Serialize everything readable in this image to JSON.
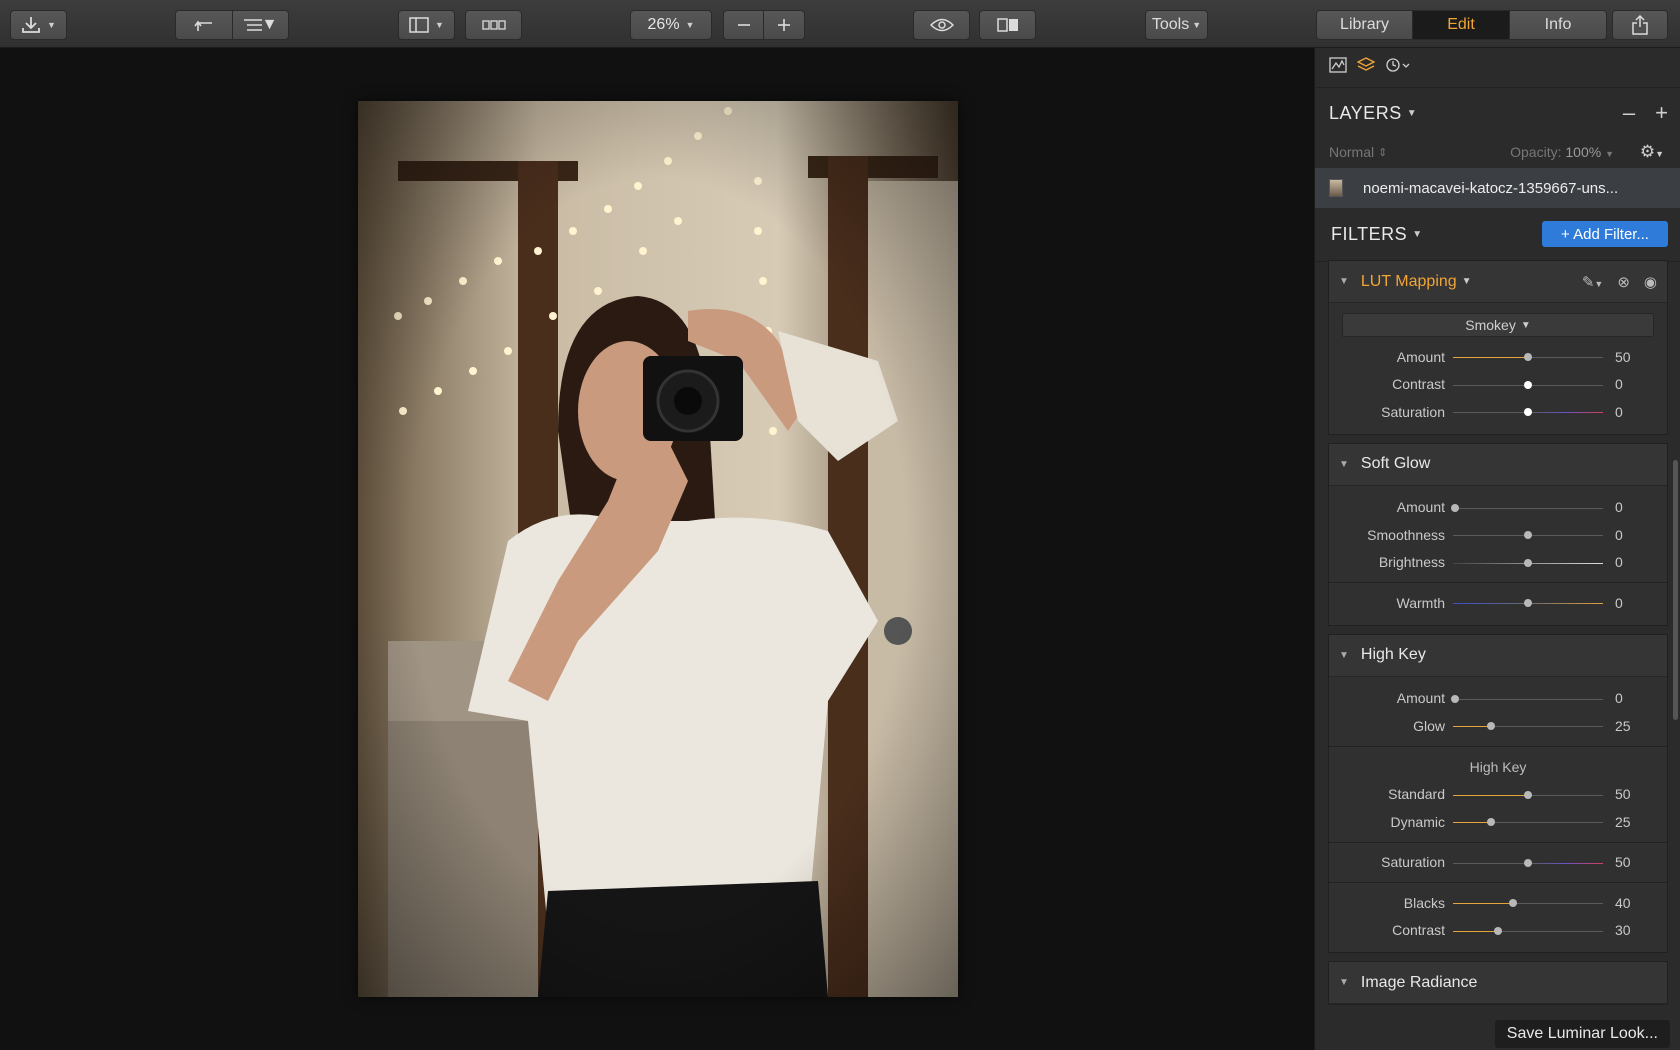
{
  "toolbar": {
    "zoom": "26%",
    "tools_label": "Tools",
    "tabs": [
      {
        "label": "Library",
        "active": false
      },
      {
        "label": "Edit",
        "active": true
      },
      {
        "label": "Info",
        "active": false
      }
    ]
  },
  "layers": {
    "title": "LAYERS",
    "blend_mode": "Normal",
    "opacity_label": "Opacity:",
    "opacity_value": "100%",
    "layer_name": "noemi-macavei-katocz-1359667-uns..."
  },
  "filters": {
    "title": "FILTERS",
    "add_label": "+ Add Filter...",
    "lut": {
      "name": "LUT Mapping",
      "preset": "Smokey",
      "sliders": [
        {
          "label": "Amount",
          "value": "50",
          "pos": 0.5,
          "fill": true
        },
        {
          "label": "Contrast",
          "value": "0",
          "pos": 0.5,
          "fill": false
        },
        {
          "label": "Saturation",
          "value": "0",
          "pos": 0.5,
          "fill": false
        }
      ]
    },
    "soft_glow": {
      "name": "Soft Glow",
      "sliders": [
        {
          "label": "Amount",
          "value": "0",
          "pos": 0.0
        },
        {
          "label": "Smoothness",
          "value": "0",
          "pos": 0.5
        },
        {
          "label": "Brightness",
          "value": "0",
          "pos": 0.5
        },
        {
          "label": "Warmth",
          "value": "0",
          "pos": 0.5
        }
      ]
    },
    "high_key": {
      "name": "High Key",
      "sub_label": "High Key",
      "sliders": [
        {
          "label": "Amount",
          "value": "0",
          "pos": 0.0
        },
        {
          "label": "Glow",
          "value": "25",
          "pos": 0.25
        },
        {
          "label": "Standard",
          "value": "50",
          "pos": 0.5
        },
        {
          "label": "Dynamic",
          "value": "25",
          "pos": 0.25
        },
        {
          "label": "Saturation",
          "value": "50",
          "pos": 0.5
        },
        {
          "label": "Blacks",
          "value": "40",
          "pos": 0.4
        },
        {
          "label": "Contrast",
          "value": "30",
          "pos": 0.3
        }
      ]
    },
    "image_radiance": {
      "name": "Image Radiance"
    }
  },
  "save_look_label": "Save Luminar Look...",
  "colors": {
    "accent": "#f0a536",
    "button_blue": "#2f7bd9",
    "panel": "#2b2b2b"
  }
}
